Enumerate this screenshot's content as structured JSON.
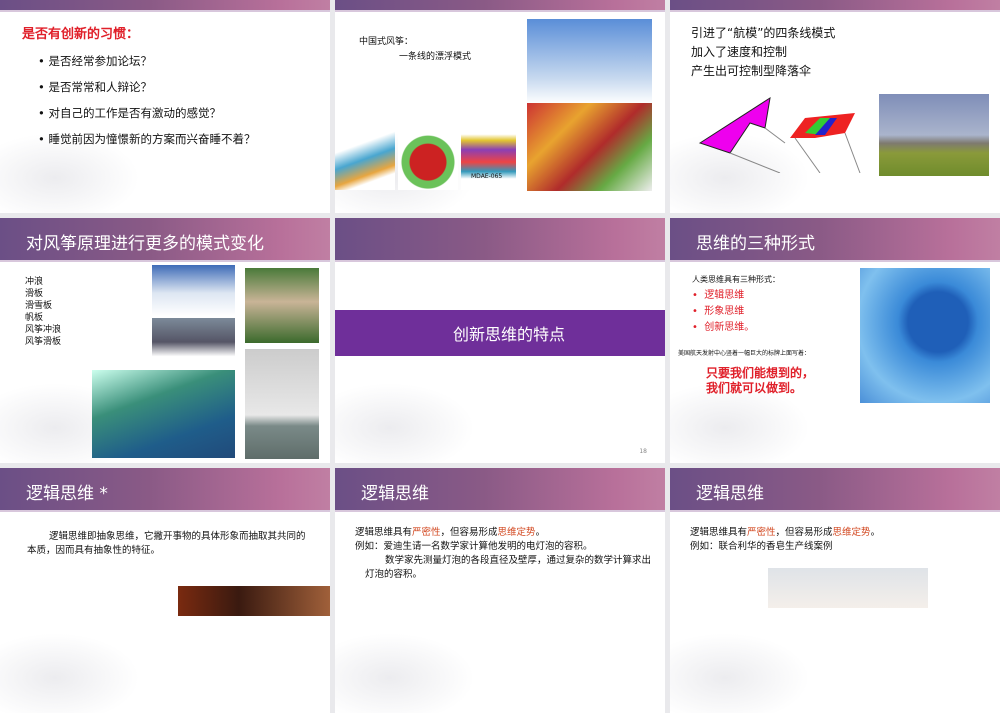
{
  "slides": [
    {
      "heading": "是否有创新的习惯：",
      "bullets": [
        "是否经常参加论坛？",
        "是否常常和人辩论？",
        "对自己的工作是否有激动的感觉？",
        "睡觉前因为憧憬新的方案而兴奋睡不着？"
      ]
    },
    {
      "line1": "中国式风筝：",
      "line2": "一条线的漂浮模式",
      "kite_label": "MDAE-065"
    },
    {
      "lines": [
        "引进了“航模”的四条线模式",
        "加入了速度和控制",
        "产生出可控制型降落伞"
      ]
    },
    {
      "title": "对风筝原理进行更多的模式变化",
      "items": [
        "冲浪",
        "滑板",
        "滑雪板",
        "帆板",
        "风筝冲浪",
        "风筝滑板"
      ]
    },
    {
      "section_title": "创新思维的特点",
      "page_number": "18"
    },
    {
      "title": "思维的三种形式",
      "intro": "人类思维具有三种形式：",
      "forms": [
        "逻辑思维",
        "形象思维",
        "创新思维。"
      ],
      "note": "美国航天发射中心竖着一幅巨大的标牌上面写着：",
      "quote1": "只要我们能想到的，",
      "quote2": "我们就可以做到。"
    },
    {
      "title": "逻辑思维 *",
      "body": "逻辑思维即抽象思维，它撇开事物的具体形象而抽取其共同的本质，因而具有抽象性的特征。"
    },
    {
      "title": "逻辑思维",
      "p1a": "逻辑思维具有",
      "p1b": "严密性",
      "p1c": "，但容易形成",
      "p1d": "思维定势",
      "p1e": "。",
      "p2": "例如：爱迪生请一名数学家计算他发明的电灯泡的容积。",
      "p3": "数学家先测量灯泡的各段直径及壁厚，通过复杂的数学计算求出灯泡的容积。"
    },
    {
      "title": "逻辑思维",
      "p1a": "逻辑思维具有",
      "p1b": "严密性",
      "p1c": "，但容易形成",
      "p1d": "思维定势",
      "p1e": "。",
      "p2": "例如：联合利华的香皂生产线案例"
    }
  ]
}
